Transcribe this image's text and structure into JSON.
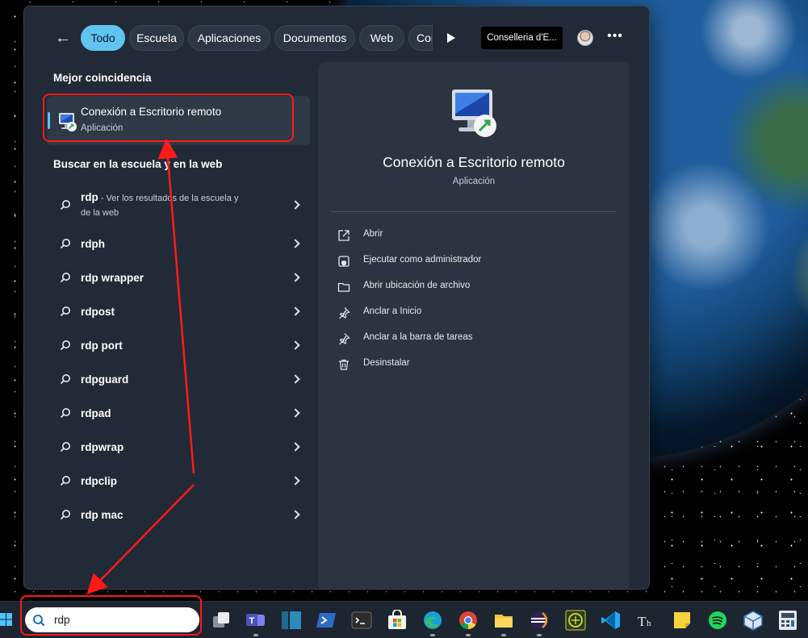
{
  "filter_bar": {
    "back_icon": "arrow-left-icon",
    "chips": [
      "Todo",
      "Escuela",
      "Aplicaciones",
      "Documentos",
      "Web",
      "Con"
    ],
    "active_chip": "Todo",
    "org_label": "Conselleria d'E...",
    "more_icon": "more-horizontal-icon"
  },
  "best_match": {
    "heading": "Mejor coincidencia",
    "title": "Conexión a Escritorio remoto",
    "subtitle": "Aplicación",
    "icon": "remote-desktop-icon"
  },
  "web_search": {
    "heading": "Buscar en la escuela y en la web",
    "results": [
      {
        "term": "rdp",
        "description": " - Ver los resultados de la escuela y",
        "description_line2": "de la web"
      },
      {
        "term": "rdph"
      },
      {
        "term": "rdp wrapper"
      },
      {
        "term": "rdpost"
      },
      {
        "term": "rdp port"
      },
      {
        "term": "rdpguard"
      },
      {
        "term": "rdpad"
      },
      {
        "term": "rdpwrap"
      },
      {
        "term": "rdpclip"
      },
      {
        "term": "rdp mac"
      }
    ]
  },
  "preview": {
    "title": "Conexión a Escritorio remoto",
    "subtitle": "Aplicación",
    "actions": [
      {
        "label": "Abrir",
        "icon": "open-external-icon"
      },
      {
        "label": "Ejecutar como administrador",
        "icon": "admin-shield-icon"
      },
      {
        "label": "Abrir ubicación de archivo",
        "icon": "folder-icon"
      },
      {
        "label": "Anclar a Inicio",
        "icon": "pin-icon"
      },
      {
        "label": "Anclar a la barra de tareas",
        "icon": "pin-icon"
      },
      {
        "label": "Desinstalar",
        "icon": "trash-icon"
      }
    ]
  },
  "taskbar": {
    "search_value": "rdp",
    "apps": [
      "task-view",
      "teams",
      "app-dark-blue",
      "powershell",
      "terminal",
      "microsoft-store",
      "edge",
      "chrome",
      "file-explorer",
      "eclipse",
      "app-green",
      "vscode",
      "typora",
      "sticky-notes",
      "spotify",
      "virtualbox",
      "calculator"
    ]
  },
  "colors": {
    "accent": "#60c3f0",
    "panel_bg": "#212a36",
    "preview_bg": "#2b3440",
    "annotation_red": "#ff1a1a"
  }
}
